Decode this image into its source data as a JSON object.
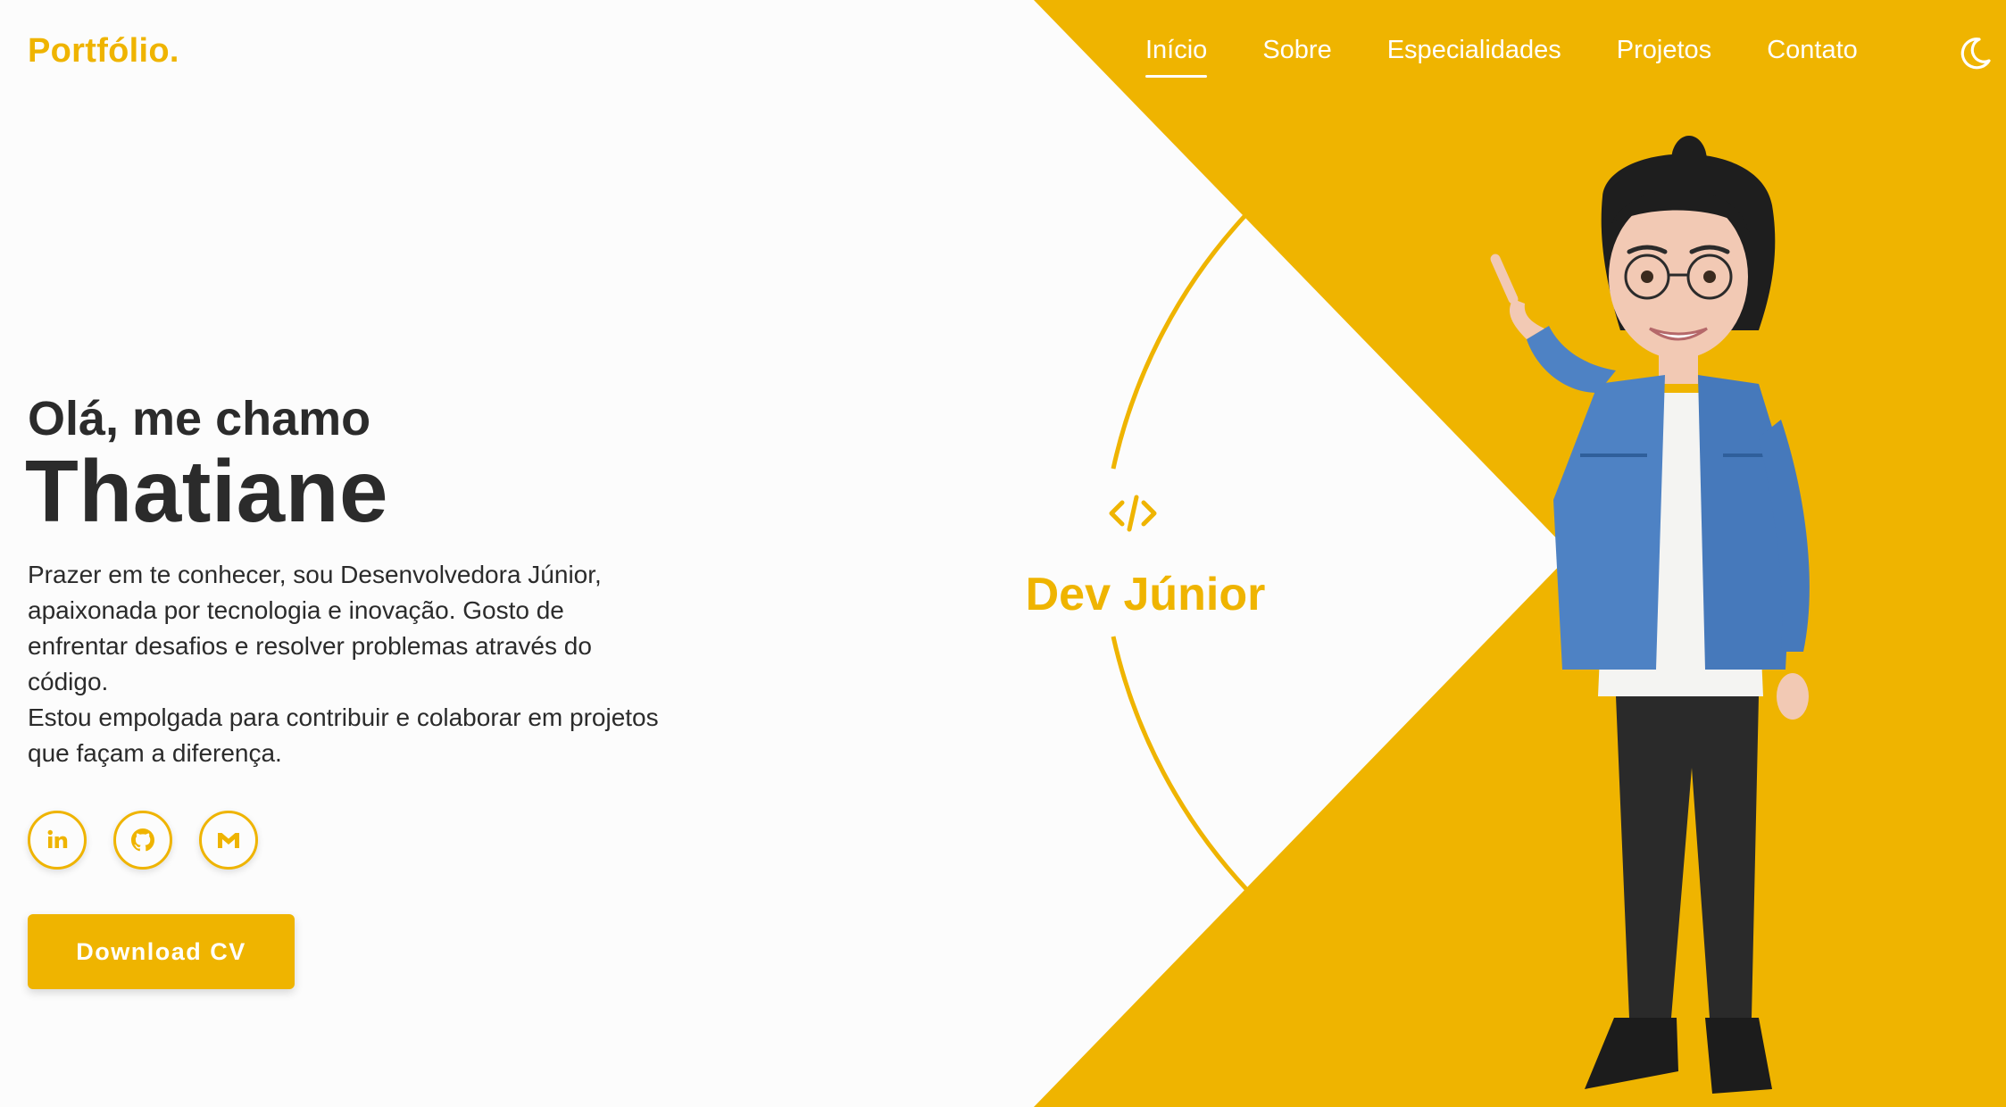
{
  "colors": {
    "accent": "#efb400",
    "background": "#fcfcfc",
    "text": "#2b2b2b",
    "nav_text": "#ffffff"
  },
  "header": {
    "logo": "Portfólio.",
    "nav": [
      {
        "label": "Início",
        "active": true
      },
      {
        "label": "Sobre",
        "active": false
      },
      {
        "label": "Especialidades",
        "active": false
      },
      {
        "label": "Projetos",
        "active": false
      },
      {
        "label": "Contato",
        "active": false
      }
    ],
    "theme_toggle_icon": "moon-icon"
  },
  "hero": {
    "greeting": "Olá, me chamo",
    "name": "Thatiane",
    "intro_line1": "Prazer em te conhecer, sou Desenvolvedora Júnior, apaixonada por tecnologia e inovação. Gosto de enfrentar desafios e resolver problemas através do código.",
    "intro_line2": "Estou empolgada para contribuir e colaborar em projetos que façam a diferença.",
    "socials": [
      {
        "icon": "linkedin-icon"
      },
      {
        "icon": "github-icon"
      },
      {
        "icon": "gmail-icon"
      }
    ],
    "download_label": "Download CV",
    "role_icon": "code-icon",
    "role": "Dev Júnior",
    "avatar_icon": "avatar-illustration"
  }
}
